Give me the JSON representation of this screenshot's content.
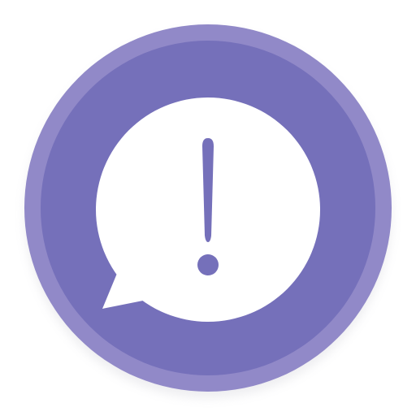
{
  "icon": {
    "name": "alert-message-icon",
    "colors": {
      "outer_ring": "#9189C8",
      "inner_disc": "#7570BA",
      "bubble": "#FFFFFF",
      "glyph": "#7570BA",
      "shadow": "#CFCFD6"
    },
    "glyph": "exclamation-mark"
  }
}
